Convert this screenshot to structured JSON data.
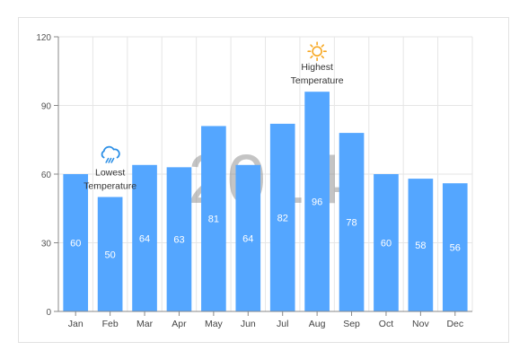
{
  "chart_data": {
    "type": "bar",
    "categories": [
      "Jan",
      "Feb",
      "Mar",
      "Apr",
      "May",
      "Jun",
      "Jul",
      "Aug",
      "Sep",
      "Oct",
      "Nov",
      "Dec"
    ],
    "values": [
      60,
      50,
      64,
      63,
      81,
      64,
      82,
      96,
      78,
      60,
      58,
      56
    ],
    "ylim": [
      0,
      120
    ],
    "yticks": [
      "0",
      "30",
      "60",
      "90",
      "120"
    ],
    "watermark": "2014",
    "annotations": [
      {
        "category": "Feb",
        "icon": "rain-cloud-icon",
        "lines": [
          "Lowest",
          "Temperature"
        ]
      },
      {
        "category": "Aug",
        "icon": "sun-icon",
        "lines": [
          "Highest",
          "Temperature"
        ]
      }
    ],
    "grid": true,
    "colors": {
      "bar": "#54a6ff",
      "label": "#ffffff",
      "sun": "#f7a823",
      "cloud": "#2a8ee6",
      "axis": "#888888",
      "grid": "#e6e6e6",
      "watermark": "#7d7d7d"
    }
  }
}
